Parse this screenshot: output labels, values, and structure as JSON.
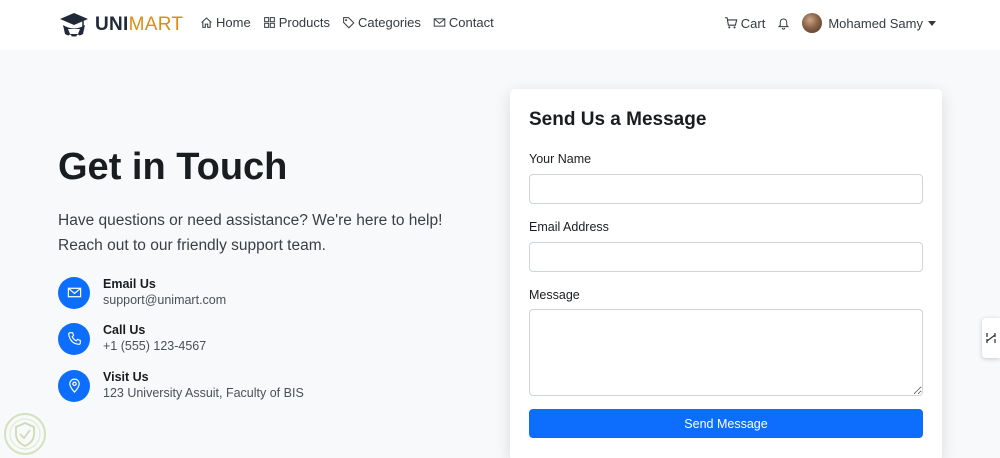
{
  "brand": {
    "strong": "UNI",
    "accent": "MART"
  },
  "nav": {
    "links": [
      {
        "label": "Home",
        "icon": "home-icon"
      },
      {
        "label": "Products",
        "icon": "grid-icon"
      },
      {
        "label": "Categories",
        "icon": "tag-icon"
      },
      {
        "label": "Contact",
        "icon": "envelope-icon"
      }
    ],
    "cart_label": "Cart",
    "user_name": "Mohamed Samy"
  },
  "hero": {
    "title": "Get in Touch",
    "subtitle": "Have questions or need assistance? We're here to help! Reach out to our friendly support team."
  },
  "contacts": [
    {
      "label": "Email Us",
      "value": "support@unimart.com",
      "icon": "envelope-icon"
    },
    {
      "label": "Call Us",
      "value": "+1 (555) 123-4567",
      "icon": "phone-icon"
    },
    {
      "label": "Visit Us",
      "value": "123 University Assuit, Faculty of BIS",
      "icon": "map-pin-icon"
    }
  ],
  "form": {
    "title": "Send Us a Message",
    "name_label": "Your Name",
    "name_value": "",
    "email_label": "Email Address",
    "email_value": "",
    "message_label": "Message",
    "message_value": "",
    "submit_label": "Send Message"
  },
  "colors": {
    "primary": "#0d6efd",
    "brand_accent": "#e08b12",
    "page_bg": "#f8f9fa"
  }
}
